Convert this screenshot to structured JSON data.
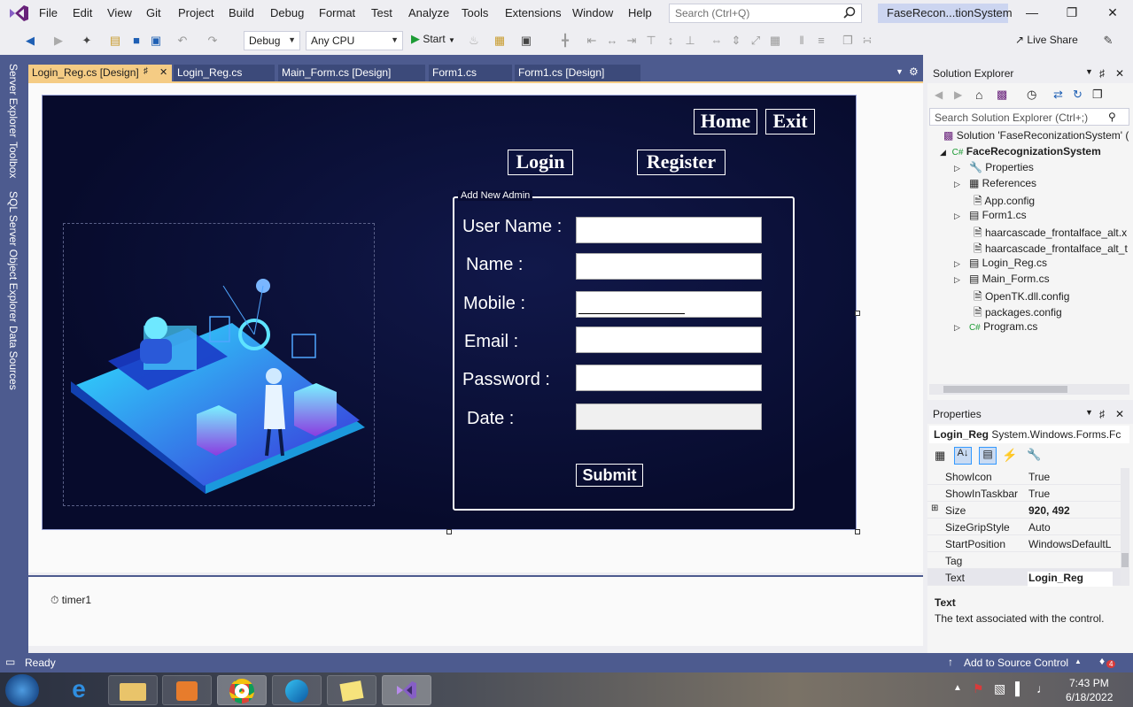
{
  "menu": {
    "items": [
      "File",
      "Edit",
      "View",
      "Git",
      "Project",
      "Build",
      "Debug",
      "Format",
      "Test",
      "Analyze",
      "Tools",
      "Extensions",
      "Window",
      "Help"
    ]
  },
  "search": {
    "placeholder": "Search (Ctrl+Q)"
  },
  "window_title": "FaseRecon...tionSystem",
  "toolbar": {
    "config": "Debug",
    "platform": "Any CPU",
    "start_label": "Start",
    "live_share": "Live Share"
  },
  "side_tabs": [
    "Server Explorer",
    "Toolbox",
    "SQL Server Object Explorer",
    "Data Sources"
  ],
  "doc_tabs": [
    {
      "label": "Login_Reg.cs [Design]",
      "active": true
    },
    {
      "label": "Login_Reg.cs",
      "active": false
    },
    {
      "label": "Main_Form.cs [Design]",
      "active": false
    },
    {
      "label": "Form1.cs",
      "active": false
    },
    {
      "label": "Form1.cs [Design]",
      "active": false
    }
  ],
  "form": {
    "home": "Home",
    "exit": "Exit",
    "login": "Login",
    "register": "Register",
    "group_title": "Add New Admin",
    "fields": [
      "User Name :",
      "Name :",
      "Mobile :",
      "Email :",
      "Password :",
      "Date :"
    ],
    "submit": "Submit"
  },
  "tray": {
    "timer": "timer1"
  },
  "solution_explorer": {
    "title": "Solution Explorer",
    "search_placeholder": "Search Solution Explorer (Ctrl+;)",
    "items": [
      "Solution 'FaseReconizationSystem' (",
      "FaceRecognizationSystem",
      "Properties",
      "References",
      "App.config",
      "Form1.cs",
      "haarcascade_frontalface_alt.x",
      "haarcascade_frontalface_alt_t",
      "Login_Reg.cs",
      "Main_Form.cs",
      "OpenTK.dll.config",
      "packages.config",
      "Program.cs"
    ]
  },
  "properties": {
    "title": "Properties",
    "object_name": "Login_Reg",
    "object_type": "System.Windows.Forms.Fc",
    "rows": [
      {
        "name": "ShowIcon",
        "value": "True"
      },
      {
        "name": "ShowInTaskbar",
        "value": "True"
      },
      {
        "name": "Size",
        "value": "920, 492"
      },
      {
        "name": "SizeGripStyle",
        "value": "Auto"
      },
      {
        "name": "StartPosition",
        "value": "WindowsDefaultL"
      },
      {
        "name": "Tag",
        "value": ""
      },
      {
        "name": "Text",
        "value": "Login_Reg"
      }
    ],
    "desc_title": "Text",
    "desc_text": "The text associated with the control."
  },
  "status": {
    "ready": "Ready",
    "source_control": "Add to Source Control",
    "notifications": "4"
  },
  "clock": {
    "time": "7:43 PM",
    "date": "6/18/2022"
  }
}
